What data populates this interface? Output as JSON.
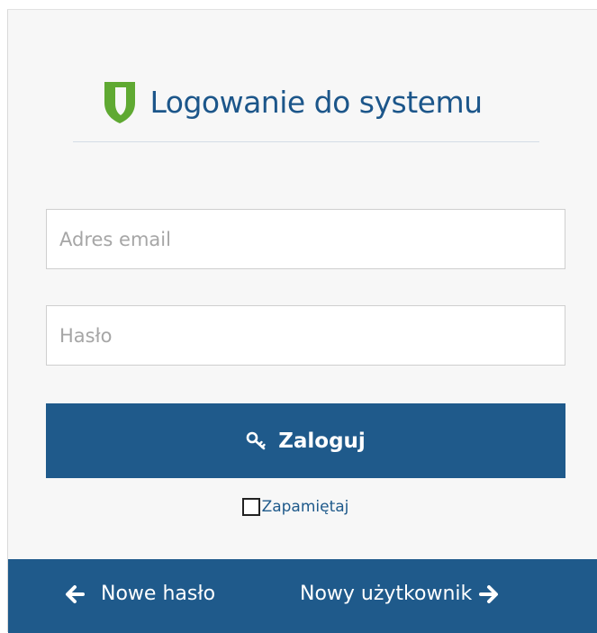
{
  "header": {
    "title": "Logowanie do systemu",
    "icon": "shield-icon",
    "icon_color": "#5fa932"
  },
  "form": {
    "email_placeholder": "Adres email",
    "email_value": "",
    "password_placeholder": "Hasło",
    "password_value": "",
    "login_label": "Zaloguj",
    "login_icon": "key-icon",
    "remember_label": "Zapamiętaj",
    "remember_checked": false
  },
  "footer": {
    "new_password_label": "Nowe hasło",
    "new_user_label": "Nowy użytkownik"
  },
  "colors": {
    "accent": "#1f5a8b",
    "title": "#1c568a",
    "panel_bg": "#f7f7f7"
  }
}
